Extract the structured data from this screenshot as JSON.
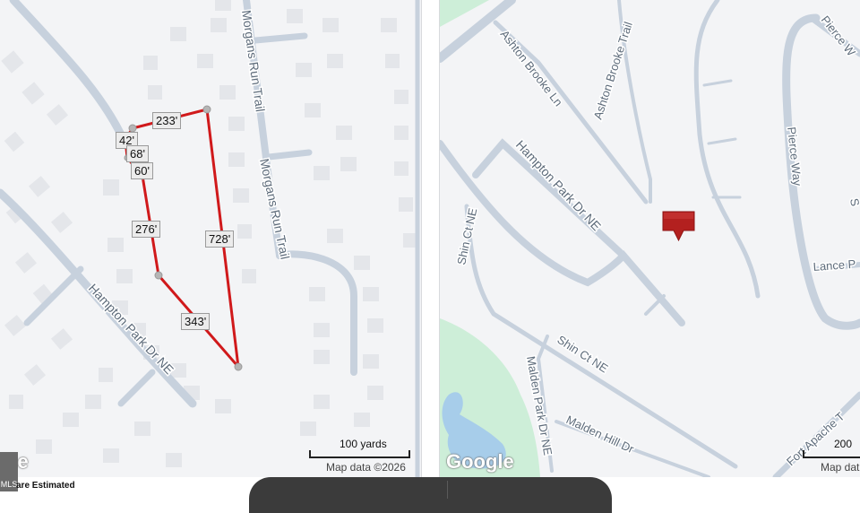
{
  "left_map": {
    "streets": {
      "morgans_run_upper": "Morgans Run Trail",
      "morgans_run_lower": "Morgans Run Trail",
      "hampton_park": "Hampton Park Dr NE"
    },
    "measurements": [
      "233'",
      "42'",
      "68'",
      "60'",
      "276'",
      "728'",
      "343'"
    ],
    "scale_label": "100 yards",
    "attribution": "Map data ©2026",
    "logo_fragment": "gle",
    "boundary_color": "#d0191b"
  },
  "right_map": {
    "streets": {
      "ashton_brooke_ln": "Ashton Brooke Ln",
      "ashton_brooke_trail": "Ashton Brooke Trail",
      "pierce_way_top": "Pierce W",
      "pierce_way": "Pierce Way",
      "hampton_park": "Hampton Park Dr NE",
      "shin_ct_upper": "Shin Ct NE",
      "shin_ct_lower": "Shin Ct NE",
      "malden_park": "Malden Park Dr NE",
      "malden_hill": "Malden Hill Dr",
      "lance": "Lance P",
      "fort_apache": "Fort Apache T",
      "edge_fragment": "S"
    },
    "scale_label": "200",
    "attribution": "Map dat",
    "logo": "Google",
    "marker_color": "#b3201f"
  },
  "footer": {
    "estimate_note": "are Estimated",
    "mls_label": "MLS"
  }
}
